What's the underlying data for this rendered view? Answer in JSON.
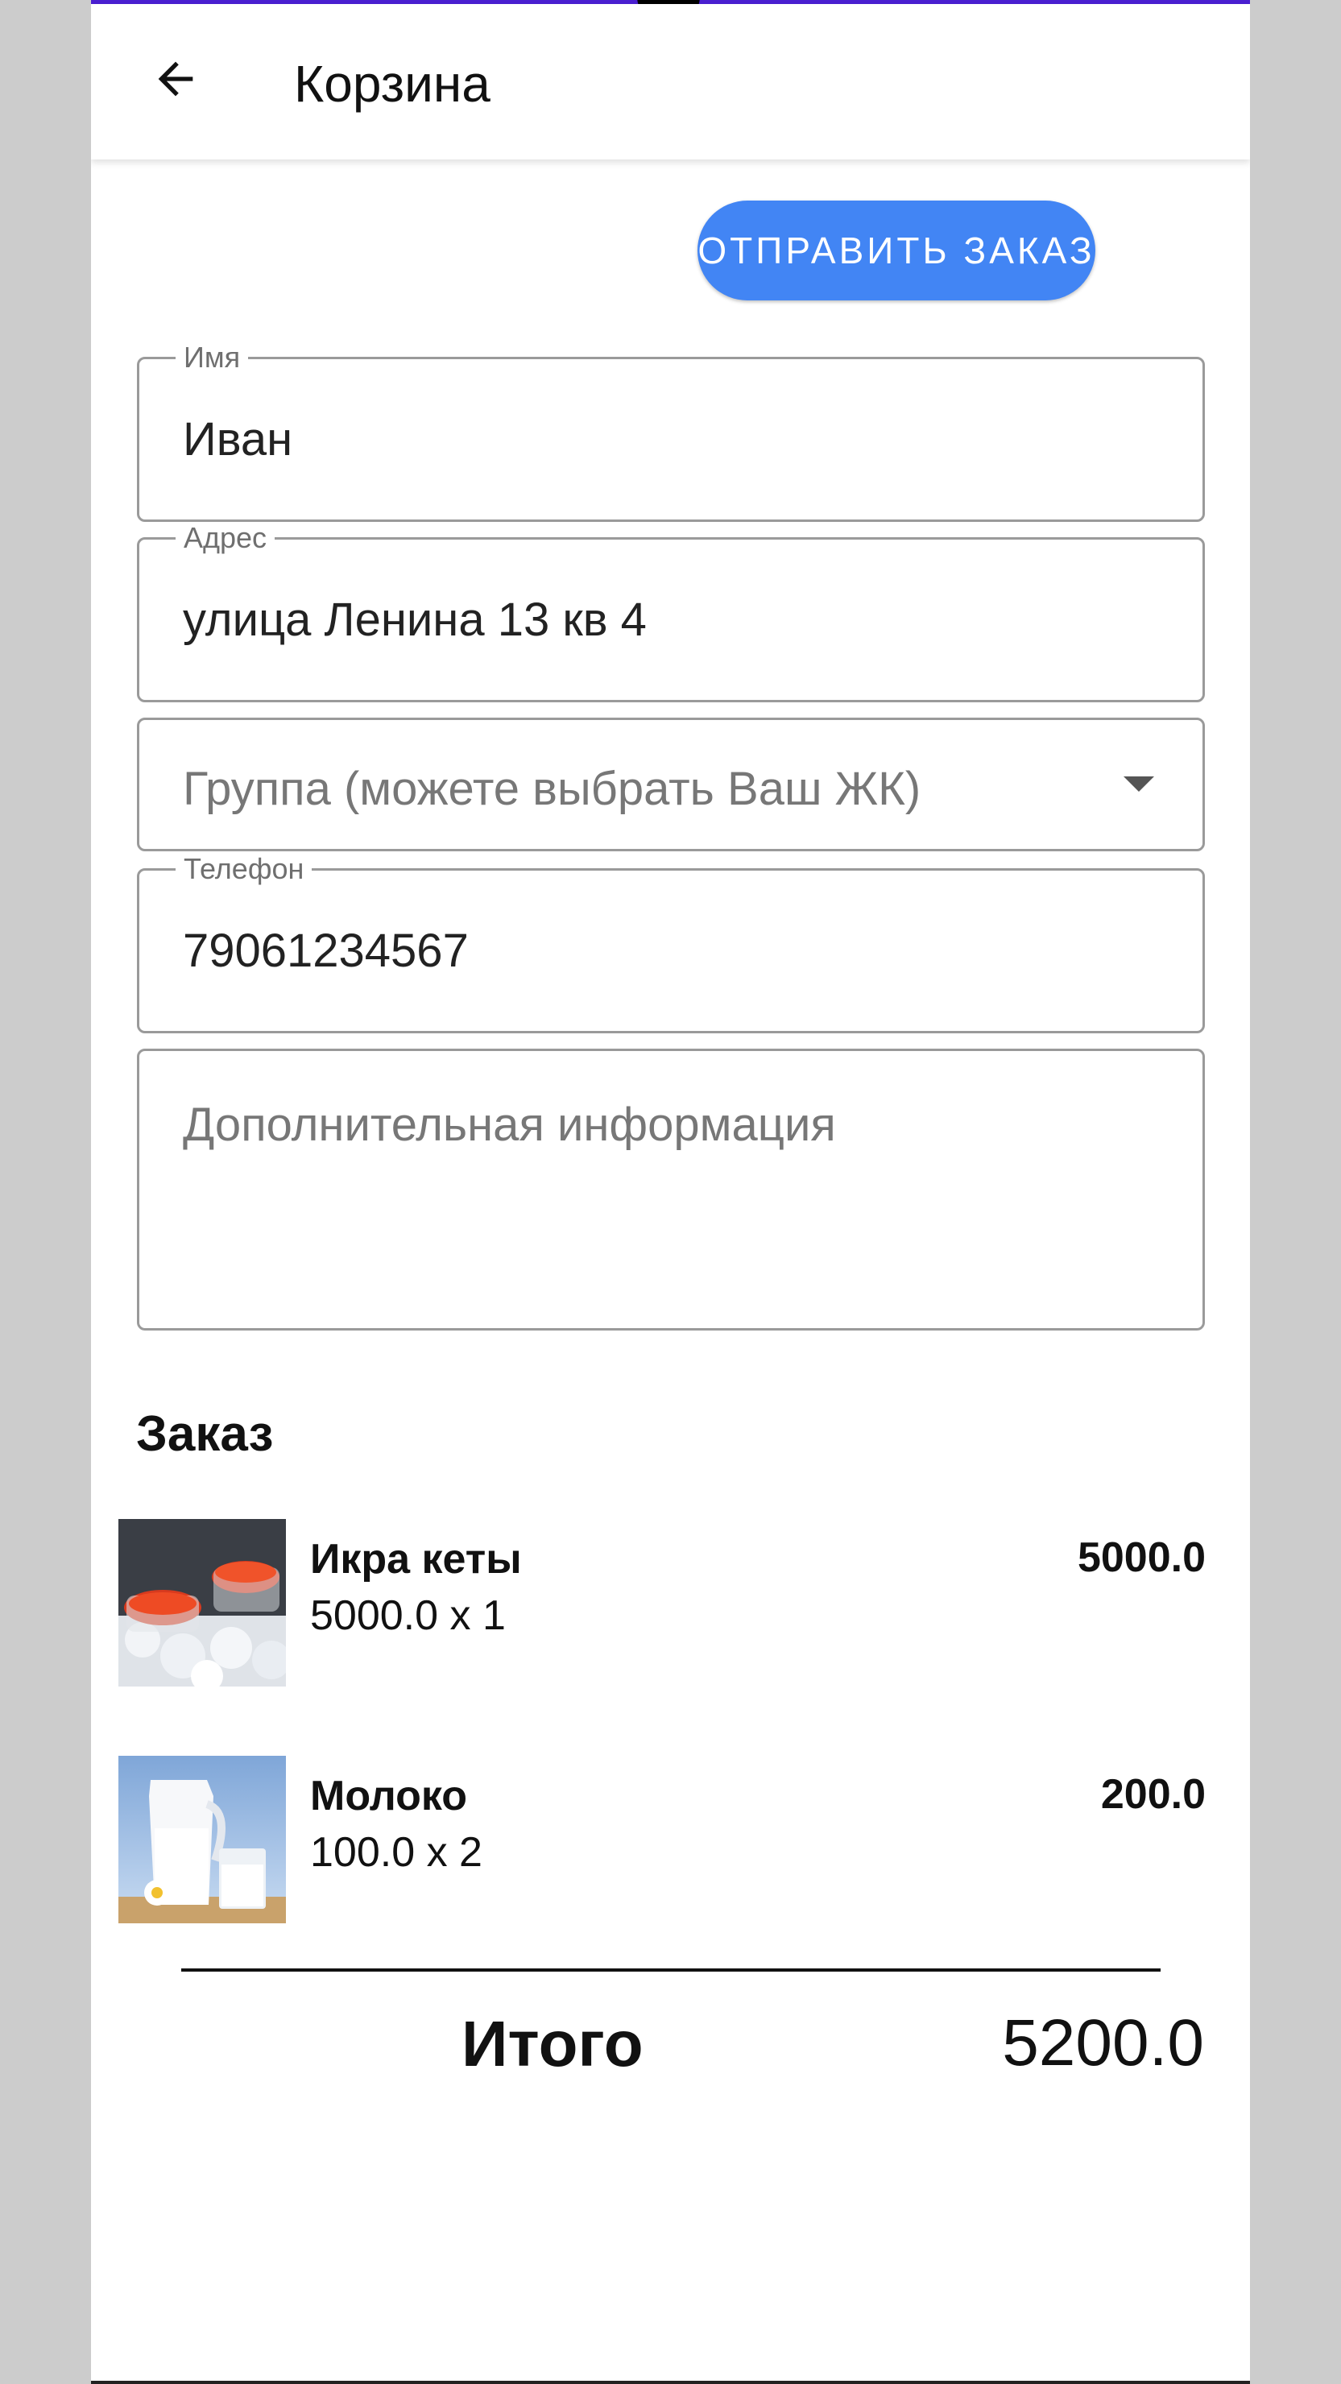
{
  "appbar": {
    "title": "Корзина",
    "back_icon": "arrow-left-icon"
  },
  "send_button": {
    "label": "ОТПРАВИТЬ ЗАКАЗ",
    "color": "#4285f4"
  },
  "form": {
    "name": {
      "label": "Имя",
      "value": "Иван"
    },
    "address": {
      "label": "Адрес",
      "value": "улица Ленина 13 кв 4"
    },
    "group": {
      "placeholder": "Группа (можете выбрать Ваш ЖК)"
    },
    "phone": {
      "label": "Телефон",
      "value": "79061234567"
    },
    "extra": {
      "placeholder": "Дополнительная информация"
    }
  },
  "order": {
    "title": "Заказ",
    "items": [
      {
        "name": "Икра кеты",
        "qty": "5000.0 x 1",
        "total": "5000.0",
        "image": "caviar-image"
      },
      {
        "name": "Молоко",
        "qty": "100.0 x 2",
        "total": "200.0",
        "image": "milk-image"
      }
    ],
    "total_label": "Итого",
    "total_value": "5200.0"
  },
  "colors": {
    "accent": "#4a1fd1",
    "button": "#4285f4",
    "background": "#cccccc"
  }
}
